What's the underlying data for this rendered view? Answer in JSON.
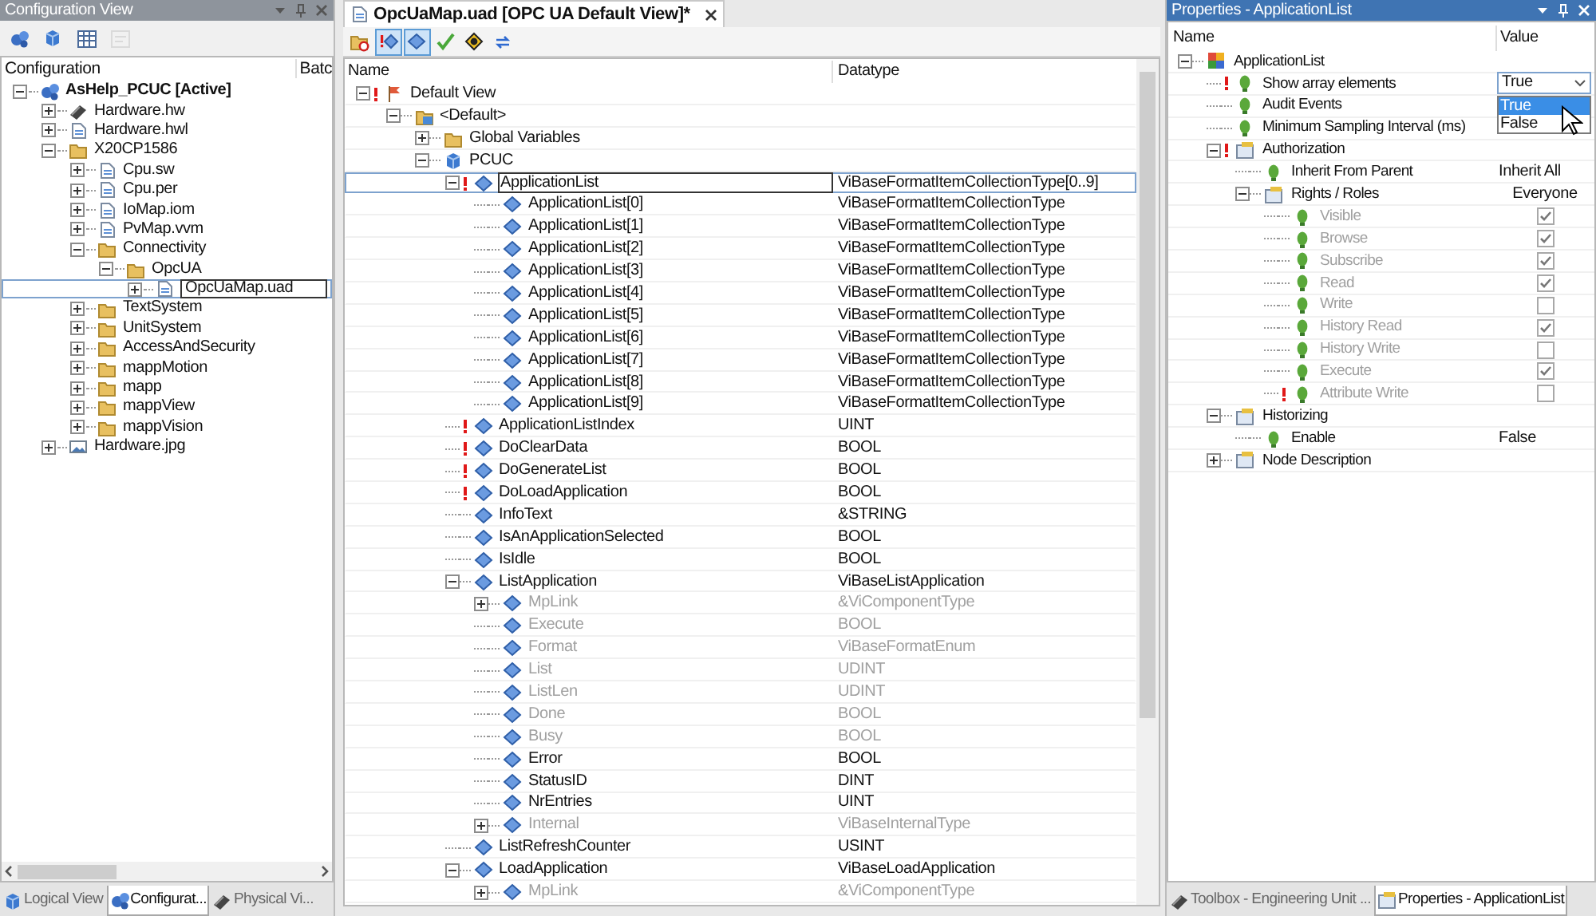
{
  "config_view": {
    "title": "Configuration View",
    "toolbar": [
      {
        "disabled": false
      },
      {
        "disabled": false
      },
      {
        "disabled": false
      },
      {
        "disabled": true
      }
    ],
    "columns": [
      "Configuration",
      "Batc"
    ],
    "tree": [
      {
        "label": "AsHelp_PCUC [Active]",
        "kind": "config",
        "expanded": true,
        "selected": false,
        "children": [
          {
            "label": "Hardware.hw",
            "kind": "hardware",
            "expanded": false,
            "selected": false
          },
          {
            "label": "Hardware.hwl",
            "kind": "file",
            "expanded": false,
            "selected": false
          },
          {
            "label": "X20CP1586",
            "kind": "folder",
            "expanded": true,
            "selected": false,
            "children": [
              {
                "label": "Cpu.sw",
                "kind": "file",
                "expanded": false,
                "selected": false
              },
              {
                "label": "Cpu.per",
                "kind": "file",
                "expanded": false,
                "selected": false
              },
              {
                "label": "IoMap.iom",
                "kind": "file",
                "expanded": false,
                "selected": false
              },
              {
                "label": "PvMap.vvm",
                "kind": "file",
                "expanded": false,
                "selected": false
              },
              {
                "label": "Connectivity",
                "kind": "folder",
                "expanded": true,
                "selected": false,
                "children": [
                  {
                    "label": "OpcUA",
                    "kind": "folder",
                    "expanded": true,
                    "selected": false,
                    "children": [
                      {
                        "label": "OpcUaMap.uad",
                        "kind": "file",
                        "expanded": false,
                        "selected": true
                      }
                    ]
                  }
                ]
              },
              {
                "label": "TextSystem",
                "kind": "folder",
                "expanded": false,
                "selected": false
              },
              {
                "label": "UnitSystem",
                "kind": "folder",
                "expanded": false,
                "selected": false
              },
              {
                "label": "AccessAndSecurity",
                "kind": "folder",
                "expanded": false,
                "selected": false
              },
              {
                "label": "mappMotion",
                "kind": "folder",
                "expanded": false,
                "selected": false
              },
              {
                "label": "mapp",
                "kind": "folder",
                "expanded": false,
                "selected": false
              },
              {
                "label": "mappView",
                "kind": "folder",
                "expanded": false,
                "selected": false
              },
              {
                "label": "mappVision",
                "kind": "folder",
                "expanded": false,
                "selected": false
              }
            ]
          },
          {
            "label": "Hardware.jpg",
            "kind": "image",
            "expanded": false,
            "selected": false
          }
        ]
      }
    ],
    "tabs": [
      {
        "label": "Logical View",
        "selected": false
      },
      {
        "label": "Configurat...",
        "selected": true
      },
      {
        "label": "Physical Vi...",
        "selected": false
      }
    ]
  },
  "editor": {
    "tab": {
      "title": "OpcUaMap.uad [OPC UA Default View]*"
    },
    "toolbar": [
      {
        "pressed": false
      },
      {
        "pressed": true
      },
      {
        "pressed": true
      },
      {
        "pressed": false
      },
      {
        "pressed": false
      },
      {
        "pressed": false
      }
    ],
    "columns": [
      "Name",
      "Datatype"
    ],
    "tree": [
      {
        "name": "Default View",
        "kind": "view",
        "expanded": true,
        "warning": true,
        "disabled": false,
        "selected": false,
        "children": [
          {
            "name": "<Default>",
            "kind": "group",
            "expanded": true,
            "warning": false,
            "disabled": false,
            "selected": false,
            "children": [
              {
                "name": "Global Variables",
                "kind": "folder",
                "expanded": false,
                "warning": false,
                "disabled": false,
                "selected": false
              },
              {
                "name": "PCUC",
                "kind": "module",
                "expanded": true,
                "warning": false,
                "disabled": false,
                "selected": false,
                "children": [
                  {
                    "name": "ApplicationList",
                    "datatype": "ViBaseFormatItemCollectionType[0..9]",
                    "kind": "variable",
                    "expanded": true,
                    "warning": true,
                    "disabled": false,
                    "selected": true,
                    "children": [
                      {
                        "name": "ApplicationList[0]",
                        "datatype": "ViBaseFormatItemCollectionType",
                        "kind": "variable",
                        "warning": false,
                        "disabled": false,
                        "selected": false
                      },
                      {
                        "name": "ApplicationList[1]",
                        "datatype": "ViBaseFormatItemCollectionType",
                        "kind": "variable",
                        "warning": false,
                        "disabled": false,
                        "selected": false
                      },
                      {
                        "name": "ApplicationList[2]",
                        "datatype": "ViBaseFormatItemCollectionType",
                        "kind": "variable",
                        "warning": false,
                        "disabled": false,
                        "selected": false
                      },
                      {
                        "name": "ApplicationList[3]",
                        "datatype": "ViBaseFormatItemCollectionType",
                        "kind": "variable",
                        "warning": false,
                        "disabled": false,
                        "selected": false
                      },
                      {
                        "name": "ApplicationList[4]",
                        "datatype": "ViBaseFormatItemCollectionType",
                        "kind": "variable",
                        "warning": false,
                        "disabled": false,
                        "selected": false
                      },
                      {
                        "name": "ApplicationList[5]",
                        "datatype": "ViBaseFormatItemCollectionType",
                        "kind": "variable",
                        "warning": false,
                        "disabled": false,
                        "selected": false
                      },
                      {
                        "name": "ApplicationList[6]",
                        "datatype": "ViBaseFormatItemCollectionType",
                        "kind": "variable",
                        "warning": false,
                        "disabled": false,
                        "selected": false
                      },
                      {
                        "name": "ApplicationList[7]",
                        "datatype": "ViBaseFormatItemCollectionType",
                        "kind": "variable",
                        "warning": false,
                        "disabled": false,
                        "selected": false
                      },
                      {
                        "name": "ApplicationList[8]",
                        "datatype": "ViBaseFormatItemCollectionType",
                        "kind": "variable",
                        "warning": false,
                        "disabled": false,
                        "selected": false
                      },
                      {
                        "name": "ApplicationList[9]",
                        "datatype": "ViBaseFormatItemCollectionType",
                        "kind": "variable",
                        "warning": false,
                        "disabled": false,
                        "selected": false
                      }
                    ]
                  },
                  {
                    "name": "ApplicationListIndex",
                    "datatype": "UINT",
                    "kind": "variable",
                    "warning": true,
                    "disabled": false,
                    "selected": false
                  },
                  {
                    "name": "DoClearData",
                    "datatype": "BOOL",
                    "kind": "variable",
                    "warning": true,
                    "disabled": false,
                    "selected": false
                  },
                  {
                    "name": "DoGenerateList",
                    "datatype": "BOOL",
                    "kind": "variable",
                    "warning": true,
                    "disabled": false,
                    "selected": false
                  },
                  {
                    "name": "DoLoadApplication",
                    "datatype": "BOOL",
                    "kind": "variable",
                    "warning": true,
                    "disabled": false,
                    "selected": false
                  },
                  {
                    "name": "InfoText",
                    "datatype": "&STRING",
                    "kind": "variable",
                    "warning": false,
                    "disabled": false,
                    "selected": false
                  },
                  {
                    "name": "IsAnApplicationSelected",
                    "datatype": "BOOL",
                    "kind": "variable",
                    "warning": false,
                    "disabled": false,
                    "selected": false
                  },
                  {
                    "name": "IsIdle",
                    "datatype": "BOOL",
                    "kind": "variable",
                    "warning": false,
                    "disabled": false,
                    "selected": false
                  },
                  {
                    "name": "ListApplication",
                    "datatype": "ViBaseListApplication",
                    "kind": "variable",
                    "expanded": true,
                    "warning": false,
                    "disabled": false,
                    "selected": false,
                    "children": [
                      {
                        "name": "MpLink",
                        "datatype": "&ViComponentType",
                        "kind": "variable",
                        "expanded": false,
                        "warning": false,
                        "disabled": true,
                        "selected": false
                      },
                      {
                        "name": "Execute",
                        "datatype": "BOOL",
                        "kind": "variable",
                        "warning": false,
                        "disabled": true,
                        "selected": false
                      },
                      {
                        "name": "Format",
                        "datatype": "ViBaseFormatEnum",
                        "kind": "variable",
                        "warning": false,
                        "disabled": true,
                        "selected": false
                      },
                      {
                        "name": "List",
                        "datatype": "UDINT",
                        "kind": "variable",
                        "warning": false,
                        "disabled": true,
                        "selected": false
                      },
                      {
                        "name": "ListLen",
                        "datatype": "UDINT",
                        "kind": "variable",
                        "warning": false,
                        "disabled": true,
                        "selected": false
                      },
                      {
                        "name": "Done",
                        "datatype": "BOOL",
                        "kind": "variable",
                        "warning": false,
                        "disabled": true,
                        "selected": false
                      },
                      {
                        "name": "Busy",
                        "datatype": "BOOL",
                        "kind": "variable",
                        "warning": false,
                        "disabled": true,
                        "selected": false
                      },
                      {
                        "name": "Error",
                        "datatype": "BOOL",
                        "kind": "variable",
                        "warning": false,
                        "disabled": false,
                        "selected": false
                      },
                      {
                        "name": "StatusID",
                        "datatype": "DINT",
                        "kind": "variable",
                        "warning": false,
                        "disabled": false,
                        "selected": false
                      },
                      {
                        "name": "NrEntries",
                        "datatype": "UINT",
                        "kind": "variable",
                        "warning": false,
                        "disabled": false,
                        "selected": false
                      },
                      {
                        "name": "Internal",
                        "datatype": "ViBaseInternalType",
                        "kind": "variable",
                        "expanded": false,
                        "warning": false,
                        "disabled": true,
                        "selected": false
                      }
                    ]
                  },
                  {
                    "name": "ListRefreshCounter",
                    "datatype": "USINT",
                    "kind": "variable",
                    "warning": false,
                    "disabled": false,
                    "selected": false
                  },
                  {
                    "name": "LoadApplication",
                    "datatype": "ViBaseLoadApplication",
                    "kind": "variable",
                    "expanded": true,
                    "warning": false,
                    "disabled": false,
                    "selected": false,
                    "children": [
                      {
                        "name": "MpLink",
                        "datatype": "&ViComponentType",
                        "kind": "variable",
                        "expanded": false,
                        "warning": false,
                        "disabled": true,
                        "selected": false
                      }
                    ]
                  }
                ]
              }
            ]
          }
        ]
      }
    ]
  },
  "properties": {
    "title": "Properties - ApplicationList",
    "columns": [
      "Name",
      "Value"
    ],
    "tree": [
      {
        "name": "ApplicationList",
        "kind": "object",
        "expanded": true,
        "warning": false,
        "disabled": false,
        "children": [
          {
            "name": "Show array elements",
            "kind": "property",
            "warning": true,
            "disabled": false,
            "value": {
              "kind": "dropdown",
              "text": "True",
              "open": true,
              "options": [
                {
                  "label": "True",
                  "selected": true
                },
                {
                  "label": "False",
                  "selected": false
                }
              ]
            }
          },
          {
            "name": "Audit Events",
            "kind": "property",
            "warning": false,
            "disabled": false
          },
          {
            "name": "Minimum Sampling Interval (ms)",
            "kind": "property",
            "warning": false,
            "disabled": false
          },
          {
            "name": "Authorization",
            "kind": "group",
            "expanded": true,
            "warning": true,
            "disabled": false,
            "children": [
              {
                "name": "Inherit From Parent",
                "kind": "property",
                "warning": false,
                "disabled": false,
                "value": {
                  "kind": "text",
                  "text": "Inherit All"
                }
              },
              {
                "name": "Rights / Roles",
                "kind": "group",
                "expanded": true,
                "warning": false,
                "disabled": false,
                "value": {
                  "kind": "heading",
                  "text": "Everyone"
                },
                "children": [
                  {
                    "name": "Visible",
                    "kind": "property",
                    "warning": false,
                    "disabled": true,
                    "value": {
                      "kind": "checkbox",
                      "checked": true
                    }
                  },
                  {
                    "name": "Browse",
                    "kind": "property",
                    "warning": false,
                    "disabled": true,
                    "value": {
                      "kind": "checkbox",
                      "checked": true
                    }
                  },
                  {
                    "name": "Subscribe",
                    "kind": "property",
                    "warning": false,
                    "disabled": true,
                    "value": {
                      "kind": "checkbox",
                      "checked": true
                    }
                  },
                  {
                    "name": "Read",
                    "kind": "property",
                    "warning": false,
                    "disabled": true,
                    "value": {
                      "kind": "checkbox",
                      "checked": true
                    }
                  },
                  {
                    "name": "Write",
                    "kind": "property",
                    "warning": false,
                    "disabled": true,
                    "value": {
                      "kind": "checkbox",
                      "checked": false
                    }
                  },
                  {
                    "name": "History Read",
                    "kind": "property",
                    "warning": false,
                    "disabled": true,
                    "value": {
                      "kind": "checkbox",
                      "checked": true
                    }
                  },
                  {
                    "name": "History Write",
                    "kind": "property",
                    "warning": false,
                    "disabled": true,
                    "value": {
                      "kind": "checkbox",
                      "checked": false
                    }
                  },
                  {
                    "name": "Execute",
                    "kind": "property",
                    "warning": false,
                    "disabled": true,
                    "value": {
                      "kind": "checkbox",
                      "checked": true
                    }
                  },
                  {
                    "name": "Attribute Write",
                    "kind": "property",
                    "warning": true,
                    "disabled": true,
                    "value": {
                      "kind": "checkbox",
                      "checked": false
                    }
                  }
                ]
              }
            ]
          },
          {
            "name": "Historizing",
            "kind": "group",
            "expanded": true,
            "warning": false,
            "disabled": false,
            "children": [
              {
                "name": "Enable",
                "kind": "property",
                "warning": false,
                "disabled": false,
                "value": {
                  "kind": "text",
                  "text": "False"
                }
              }
            ]
          },
          {
            "name": "Node Description",
            "kind": "group",
            "expanded": false,
            "warning": false,
            "disabled": false
          }
        ]
      }
    ],
    "tabs": [
      {
        "label": "Toolbox - Engineering Unit ...",
        "selected": false
      },
      {
        "label": "Properties - ApplicationList",
        "selected": true
      }
    ]
  }
}
